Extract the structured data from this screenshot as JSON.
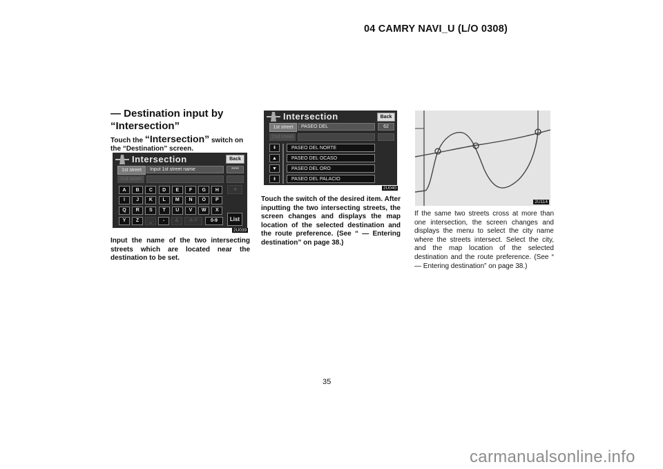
{
  "header": {
    "doc_id": "04 CAMRY NAVI_U (L/O 0308)"
  },
  "section": {
    "title": "— Destination input by “Intersection”",
    "intro_prefix": "Touch the ",
    "intro_switch": "“Intersection”",
    "intro_suffix": " switch on the “Destination” screen."
  },
  "screen1": {
    "title": "Intersection",
    "back": "Back",
    "tab1": "1st street",
    "tab2": "2nd street",
    "field1": "Input 1st street name",
    "count": "****",
    "keys_row1": [
      "A",
      "B",
      "C",
      "D",
      "E",
      "F",
      "G",
      "H"
    ],
    "keys_row2": [
      "I",
      "J",
      "K",
      "L",
      "M",
      "N",
      "O",
      "P"
    ],
    "keys_row3": [
      "Q",
      "R",
      "S",
      "T",
      "U",
      "V",
      "W",
      "X"
    ],
    "keys_row4": [
      "Y",
      "Z",
      "␣",
      "-",
      "&",
      "A-Y",
      "0-9"
    ],
    "list": "List",
    "delete": "◄",
    "code": "2U039"
  },
  "caption1": "Input the name of the two intersecting streets which are located near the destination to be set.",
  "screen2": {
    "title": "Intersection",
    "back": "Back",
    "tab1": "1st street",
    "tab2": "2nd street",
    "field1": "PASEO DEL",
    "count": "62",
    "items": [
      "PASEO DEL NORTE",
      "PASEO DEL OCASO",
      "PASEO DEL ORO",
      "PASEO DEL PALACIO"
    ],
    "arrows": [
      "⇞",
      "▲",
      "▼",
      "⇟"
    ],
    "code": "2U040"
  },
  "caption2": "Touch the switch of the desired item. After inputting the two intersecting streets, the screen changes and displays the map location of the selected destination and the route preference. (See “ — Entering destination” on page 38.)",
  "map": {
    "code": "2U114",
    "intersections": 3
  },
  "caption3": "If the same two streets cross at more than one intersection, the screen changes and displays the menu to select the city name where the streets intersect. Select the city, and the map location of the selected destination and the route preference. (See “ — Entering destination” on page 38.)",
  "footer": {
    "page_number": "35",
    "watermark": "carmanualsonline.info"
  }
}
